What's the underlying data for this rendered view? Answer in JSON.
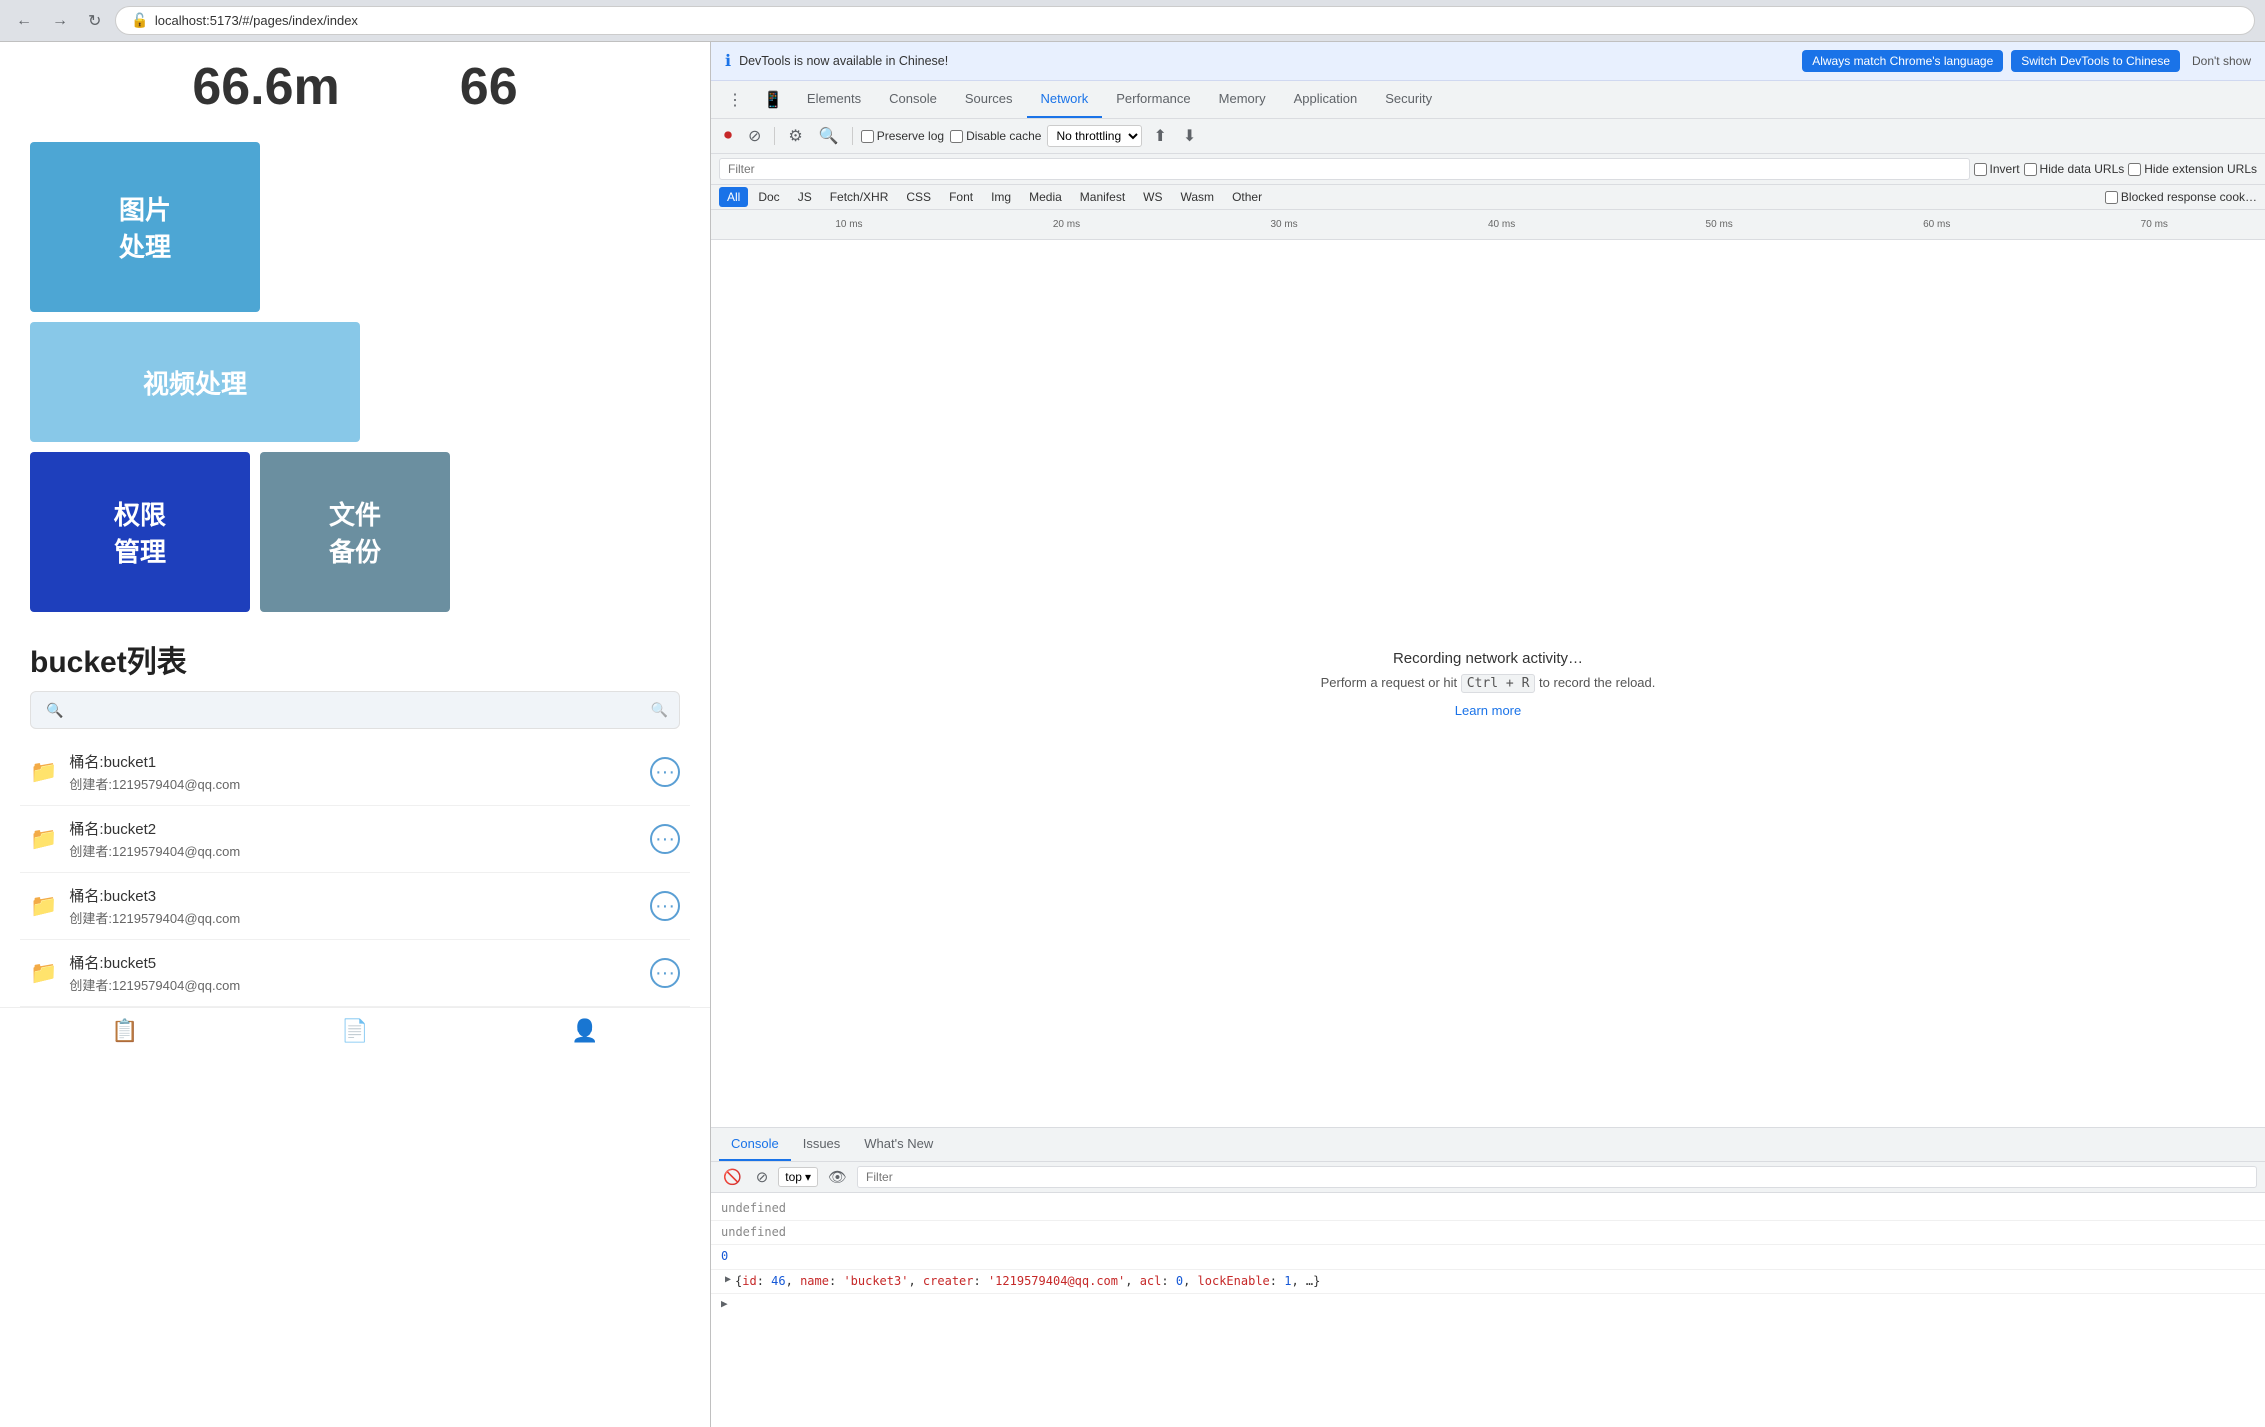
{
  "browser": {
    "address": "localhost:5173/#/pages/index/index"
  },
  "devtools_notification": {
    "icon": "ℹ",
    "text": "DevTools is now available in Chinese!",
    "btn_match": "Always match Chrome's language",
    "btn_switch": "Switch DevTools to Chinese",
    "btn_dontshow": "Don't show"
  },
  "devtools_tabs": [
    {
      "label": "⠿",
      "icon": true
    },
    {
      "label": "📱",
      "icon": true
    },
    {
      "label": "Elements"
    },
    {
      "label": "Console"
    },
    {
      "label": "Sources"
    },
    {
      "label": "Network",
      "active": true
    },
    {
      "label": "Performance"
    },
    {
      "label": "Memory"
    },
    {
      "label": "Application"
    },
    {
      "label": "Security"
    }
  ],
  "network_toolbar": {
    "record_btn": "⏺",
    "stop_btn": "🚫",
    "clear_btn": "🚫",
    "filter_btn": "⚙",
    "search_btn": "🔍",
    "preserve_log_label": "Preserve log",
    "disable_cache_label": "Disable cache",
    "throttle_value": "No throttling",
    "upload_icon": "⬆",
    "download_icon": "⬇"
  },
  "filter_bar": {
    "placeholder": "Filter",
    "invert_label": "Invert",
    "hide_data_urls_label": "Hide data URLs",
    "hide_extension_urls_label": "Hide extension URLs"
  },
  "type_filters": [
    "All",
    "Doc",
    "JS",
    "Fetch/XHR",
    "CSS",
    "Font",
    "Img",
    "Media",
    "Manifest",
    "WS",
    "Wasm",
    "Other"
  ],
  "type_filter_active": "All",
  "blocked_response_cookies_label": "Blocked response cook…",
  "timeline": {
    "marks": [
      "10 ms",
      "20 ms",
      "30 ms",
      "40 ms",
      "50 ms",
      "60 ms",
      "70 ms"
    ]
  },
  "network_empty": {
    "title": "Recording network activity…",
    "text_part1": "Perform a request or hit",
    "shortcut": "Ctrl + R",
    "text_part2": "to record the reload.",
    "learn_more": "Learn more"
  },
  "console_tabs": [
    {
      "label": "Console",
      "active": true
    },
    {
      "label": "Issues"
    },
    {
      "label": "What's New"
    }
  ],
  "console_toolbar": {
    "clear_icon": "🚫",
    "filter_icon": "⊘",
    "context": "top",
    "eye_icon": "👁",
    "filter_placeholder": "Filter"
  },
  "console_lines": [
    {
      "type": "undefined",
      "text": "undefined"
    },
    {
      "type": "undefined",
      "text": "undefined"
    },
    {
      "type": "number",
      "text": "0"
    },
    {
      "type": "object",
      "text": "▶ {id: 46, name: 'bucket3', creater: '1219579404@qq.com', acl: 0, lockEnable: 1, …}"
    },
    {
      "type": "arrow",
      "text": "▶"
    }
  ],
  "page": {
    "stats": [
      "66.6m",
      "66"
    ],
    "tiles": [
      {
        "label": "图片\n处理",
        "color": "#4da6d4"
      },
      {
        "label": "视频处理",
        "color": "#88c8e8"
      },
      {
        "label": "权限\n管理",
        "color": "#1e3fbc"
      },
      {
        "label": "文件\n备份",
        "color": "#6b8fa0"
      }
    ],
    "bucket_title": "bucket列表",
    "search_placeholder": "🔍",
    "buckets": [
      {
        "name": "桶名:bucket1",
        "creator": "创建者:1219579404@qq.com"
      },
      {
        "name": "桶名:bucket2",
        "creator": "创建者:1219579404@qq.com"
      },
      {
        "name": "桶名:bucket3",
        "creator": "创建者:1219579404@qq.com"
      },
      {
        "name": "桶名:bucket5",
        "creator": "创建者:1219579404@qq.com"
      }
    ]
  }
}
